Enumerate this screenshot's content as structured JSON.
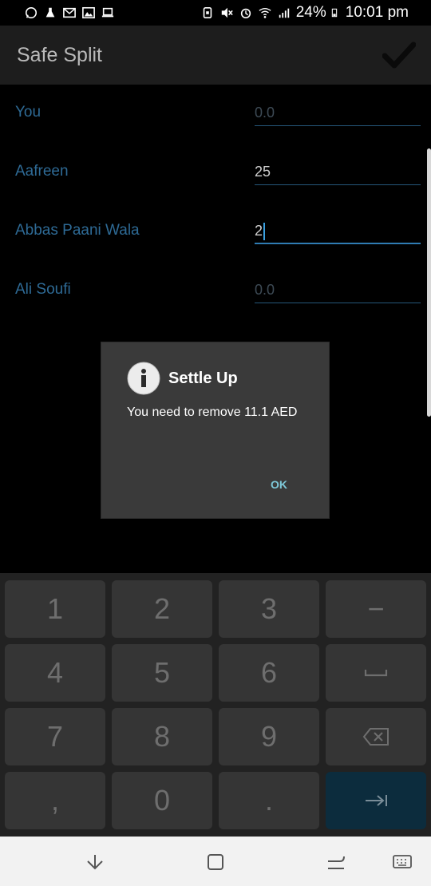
{
  "status_bar": {
    "battery": "24%",
    "time": "10:01 pm"
  },
  "app_bar": {
    "title": "Safe Split",
    "confirm_icon": "check-icon"
  },
  "form": {
    "rows": [
      {
        "label": "You",
        "value": "",
        "placeholder": "0.0"
      },
      {
        "label": "Aafreen",
        "value": "25",
        "placeholder": ""
      },
      {
        "label": "Abbas Paani Wala",
        "value": "2",
        "placeholder": ""
      },
      {
        "label": "Ali Soufi",
        "value": "",
        "placeholder": "0.0"
      }
    ]
  },
  "dialog": {
    "icon": "info-icon",
    "title": "Settle Up",
    "message": "You need to remove 11.1 AED",
    "ok_label": "OK"
  },
  "keyboard": {
    "keys": [
      "1",
      "2",
      "3",
      "−",
      "4",
      "5",
      "6",
      "space",
      "7",
      "8",
      "9",
      "backspace",
      ",",
      "0",
      ".",
      "enter"
    ],
    "labels": {
      "k1": "1",
      "k2": "2",
      "k3": "3",
      "minus": "−",
      "k4": "4",
      "k5": "5",
      "k6": "6",
      "k7": "7",
      "k8": "8",
      "k9": "9",
      "comma": ",",
      "k0": "0",
      "period": "."
    }
  },
  "colors": {
    "label": "#2e6a95",
    "underline": "#25577a",
    "dialog_bg": "#3a3a3a",
    "ok": "#7ec8d8",
    "enter_key": "#0c2c3d"
  }
}
